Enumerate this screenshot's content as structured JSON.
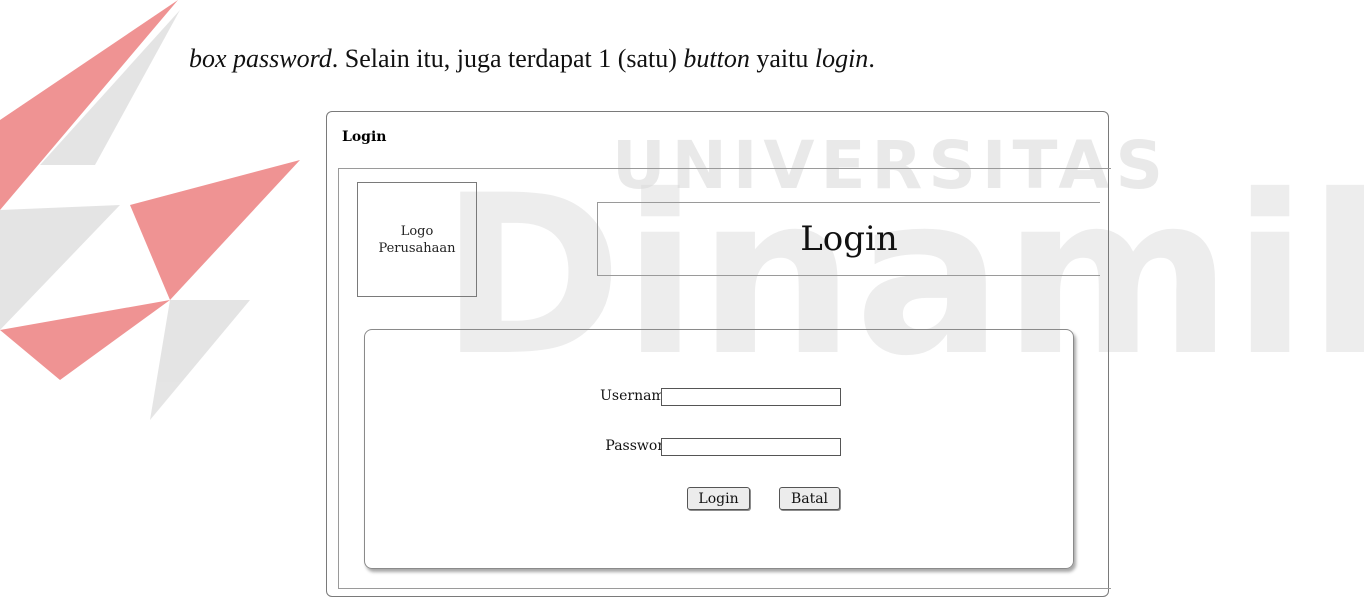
{
  "caption": {
    "part1": "box password",
    "part2": ". Selain itu, juga terdapat 1 (satu) ",
    "part3": "button",
    "part4": " yaitu ",
    "part5": "login",
    "part6": "."
  },
  "watermark": {
    "line1": "UNIVERSITAS",
    "line2": "Dinamika",
    "text_color": "#d8d8d8",
    "emblem_colors": [
      "#e23b3b",
      "#cfcfcf"
    ]
  },
  "window": {
    "title": "Login",
    "logo_text": "Logo\nPerusahaan",
    "header_text": "Login"
  },
  "form": {
    "username_label": "Username",
    "password_label": "Password",
    "username_value": "",
    "password_value": "",
    "login_button": "Login",
    "cancel_button": "Batal"
  }
}
